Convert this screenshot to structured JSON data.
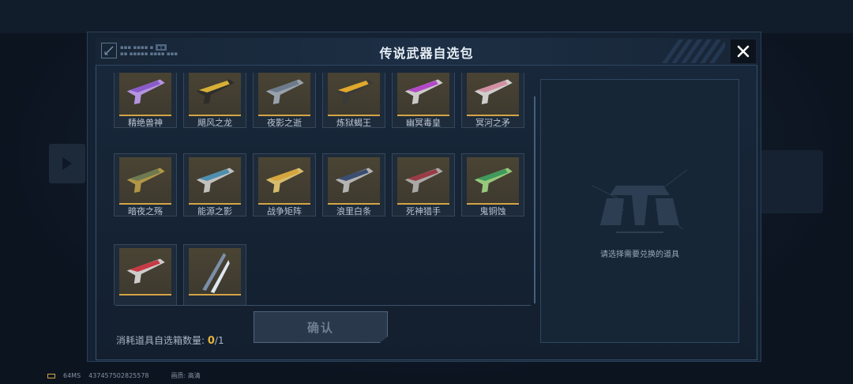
{
  "dialog": {
    "title": "传说武器自选包"
  },
  "items": [
    {
      "name": "精绝兽神"
    },
    {
      "name": "飓风之龙"
    },
    {
      "name": "夜影之逝"
    },
    {
      "name": "炼狱蝎王"
    },
    {
      "name": "幽冥毒皇"
    },
    {
      "name": "冥河之矛"
    },
    {
      "name": "暗夜之殇"
    },
    {
      "name": "能源之影"
    },
    {
      "name": "战争矩阵"
    },
    {
      "name": "浪里白条"
    },
    {
      "name": "死神猎手"
    },
    {
      "name": "鬼铜蚀"
    },
    {
      "name": ""
    },
    {
      "name": ""
    }
  ],
  "footer": {
    "consume_label": "消耗道具自选箱数量:",
    "current": "0",
    "total": "/1",
    "confirm_label": "确认"
  },
  "detail": {
    "hint": "请选择需要兑换的道具"
  },
  "status": {
    "ping": "64MS",
    "uid": "437457502825578",
    "quality": "画质: 高清"
  },
  "colors": {
    "accent_gold": "#d3a447",
    "count_highlight": "#e6b33c"
  },
  "icons": [
    "close-icon",
    "crosshair-logo-icon",
    "battery-icon"
  ]
}
